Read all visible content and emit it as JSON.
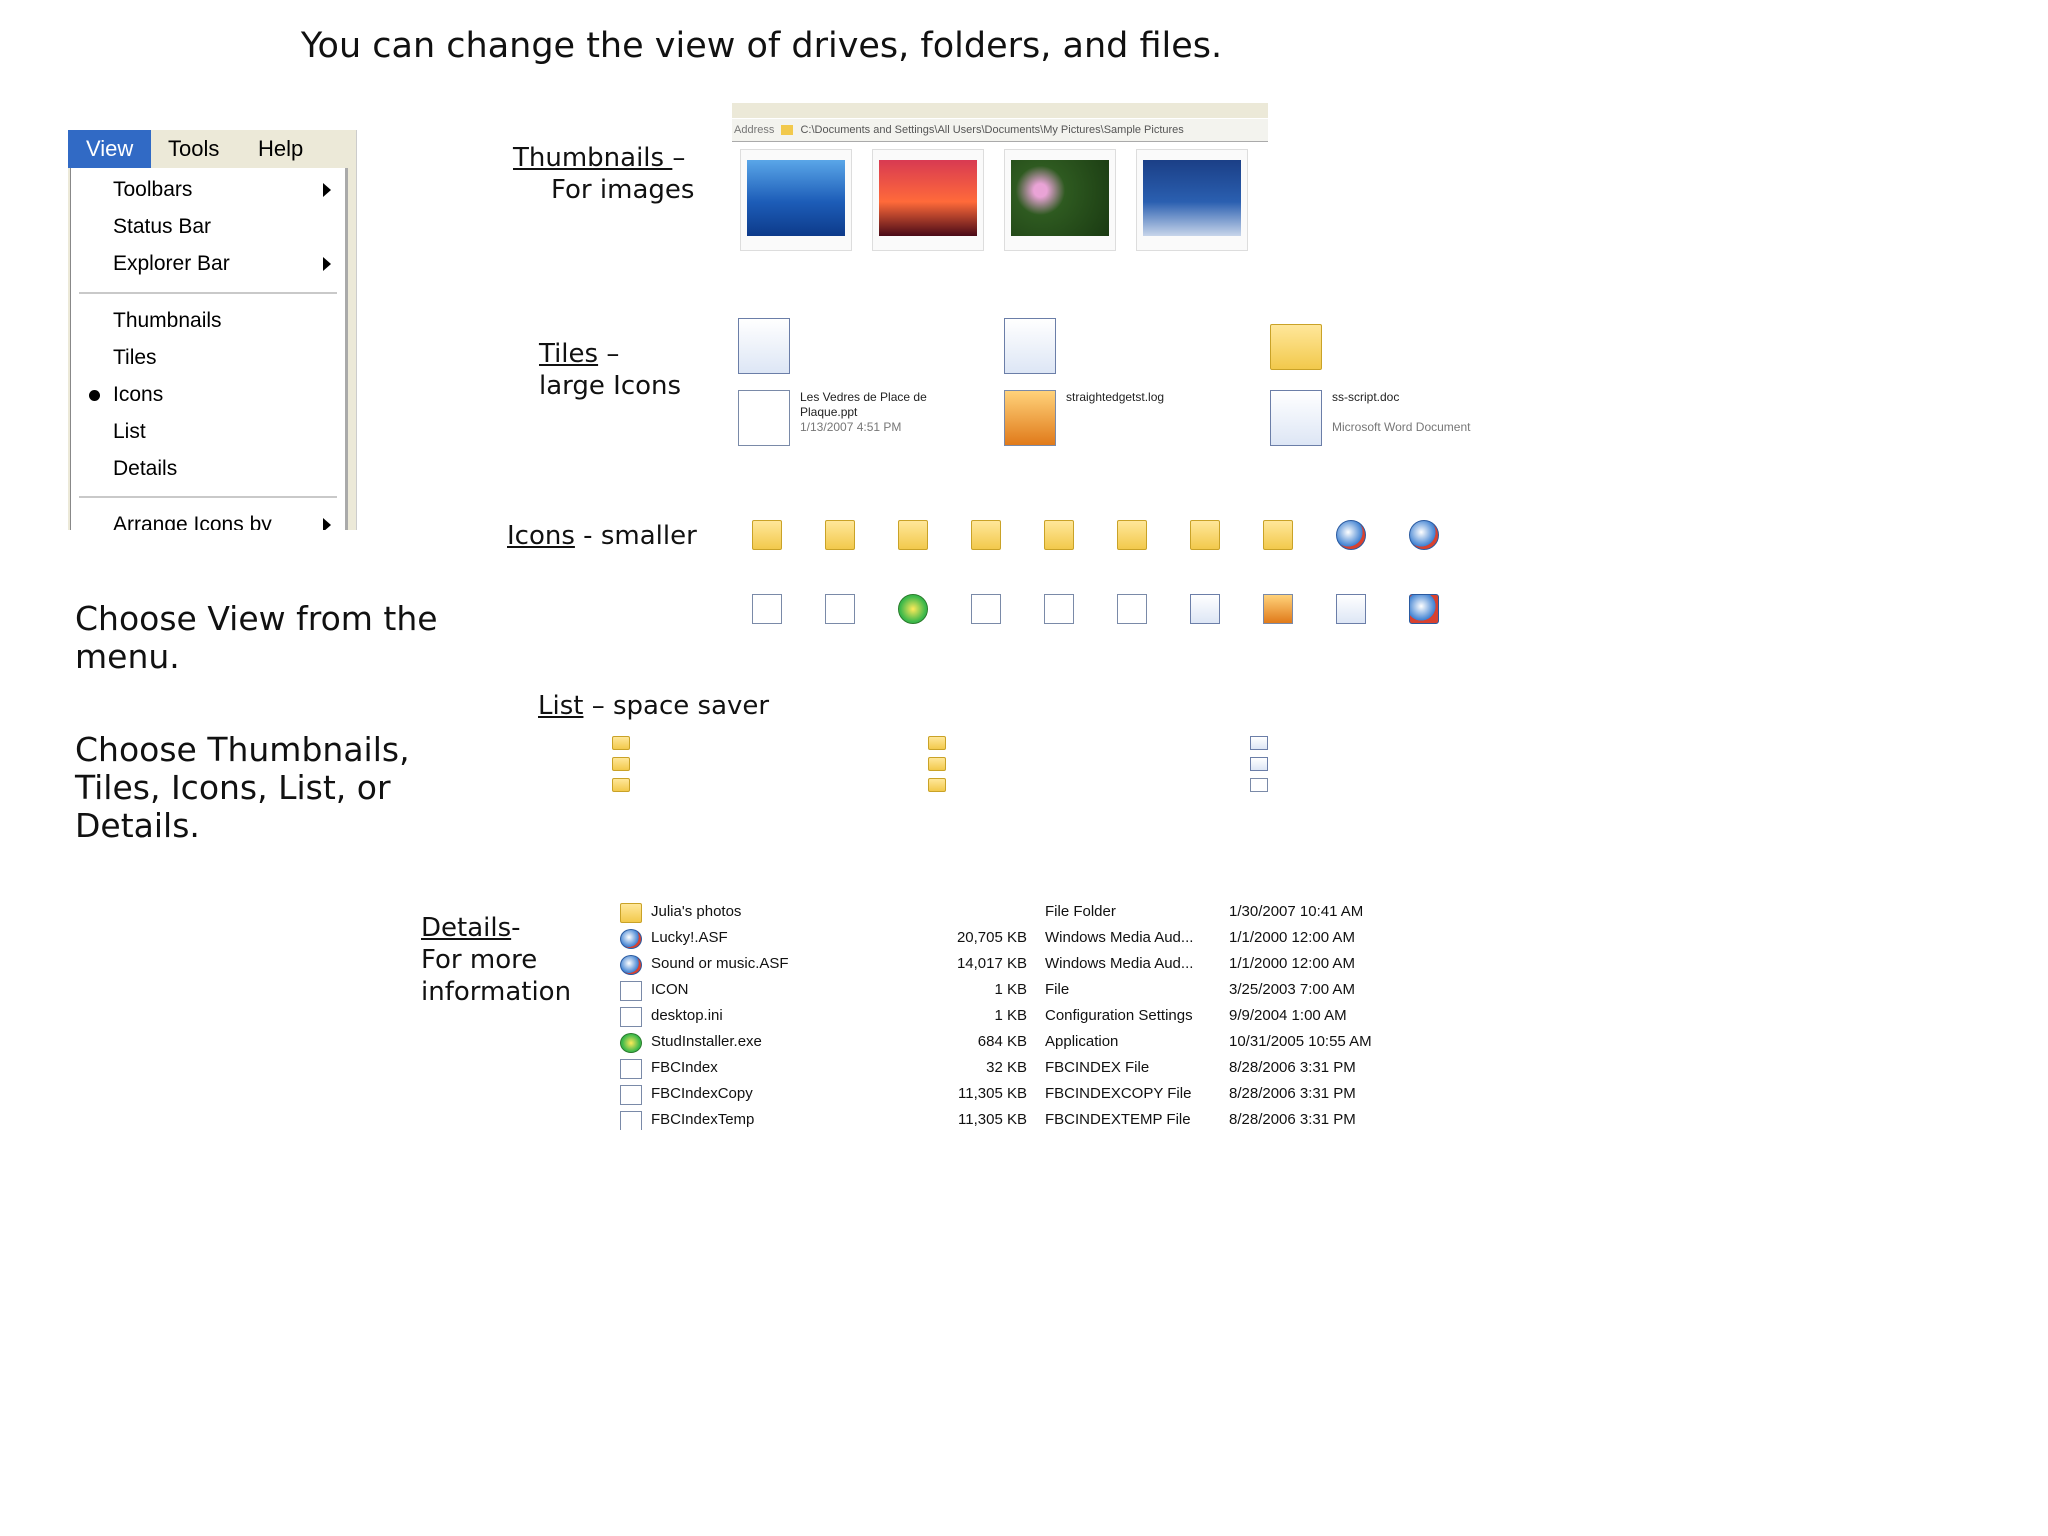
{
  "title": "You can change the view of drives, folders, and files.",
  "menu": {
    "bar": [
      "View",
      "Tools",
      "Help"
    ],
    "items": [
      "Toolbars",
      "Status Bar",
      "Explorer Bar",
      "Thumbnails",
      "Tiles",
      "Icons",
      "List",
      "Details",
      "Arrange Icons by"
    ],
    "selected": "Icons"
  },
  "instructions": {
    "line1": "Choose View from the menu.",
    "line2": "Choose Thumbnails, Tiles, Icons, List, or Details."
  },
  "views": {
    "thumbnails": {
      "name": "Thumbnails ",
      "desc": "For images"
    },
    "tiles": {
      "name": "Tiles",
      "desc": "large Icons"
    },
    "icons": {
      "name": "Icons",
      "desc": "smaller"
    },
    "list": {
      "name": "List",
      "desc": "space saver"
    },
    "details": {
      "name": "Details",
      "desc": "For more information"
    }
  },
  "thumb_panel": {
    "address_label": "Address",
    "address": "C:\\Documents and Settings\\All Users\\Documents\\My Pictures\\Sample Pictures"
  },
  "tiles_panel": [
    {
      "name": "Les Vedres de Place de",
      "name2": "Plaque.ppt",
      "date": "1/13/2007 4:51 PM"
    },
    {
      "name": "straightedgetst.log",
      "name2": "",
      "date": ""
    },
    {
      "name": "ss-script.doc",
      "name2": "",
      "date": "Microsoft Word Document"
    }
  ],
  "details_panel": {
    "rows": [
      {
        "name": "Julia's photos",
        "size": "",
        "type": "File Folder",
        "modified": "1/30/2007 10:41 AM"
      },
      {
        "name": "Lucky!.ASF",
        "size": "20,705 KB",
        "type": "Windows Media Aud...",
        "modified": "1/1/2000 12:00 AM"
      },
      {
        "name": "Sound or music.ASF",
        "size": "14,017 KB",
        "type": "Windows Media Aud...",
        "modified": "1/1/2000 12:00 AM"
      },
      {
        "name": "ICON",
        "size": "1 KB",
        "type": "File",
        "modified": "3/25/2003 7:00 AM"
      },
      {
        "name": "desktop.ini",
        "size": "1 KB",
        "type": "Configuration Settings",
        "modified": "9/9/2004 1:00 AM"
      },
      {
        "name": "StudInstaller.exe",
        "size": "684 KB",
        "type": "Application",
        "modified": "10/31/2005 10:55 AM"
      },
      {
        "name": "FBCIndex",
        "size": "32 KB",
        "type": "FBCINDEX File",
        "modified": "8/28/2006 3:31 PM"
      },
      {
        "name": "FBCIndexCopy",
        "size": "11,305 KB",
        "type": "FBCINDEXCOPY File",
        "modified": "8/28/2006 3:31 PM"
      },
      {
        "name": "FBCIndexTemp",
        "size": "11,305 KB",
        "type": "FBCINDEXTEMP File",
        "modified": "8/28/2006 3:31 PM"
      }
    ]
  }
}
